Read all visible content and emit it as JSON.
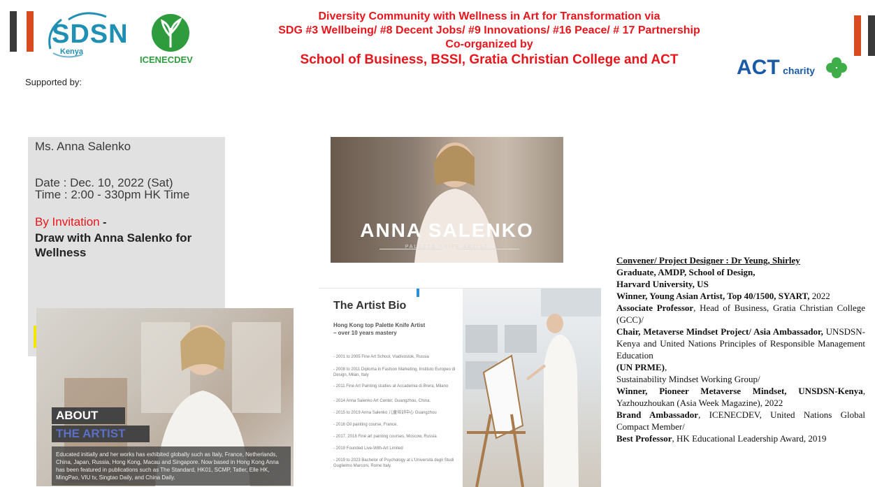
{
  "header": {
    "title_lines": [
      "Diversity Community with Wellness in Art for Transformation via",
      "SDG #3 Wellbeing/ #8 Decent Jobs/ #9 Innovations/ #16 Peace/ # 17 Partnership",
      "Co-organized by",
      "School of Business, BSSI, Gratia Christian College and ACT"
    ],
    "supported_by": "Supported by:",
    "logos": {
      "sdsn": "SDSN",
      "sdsn_sub": "Kenya",
      "icenecdev": "ICENECDEV",
      "act": "ACT",
      "act_sub": "charity"
    }
  },
  "event": {
    "speaker": "Ms. Anna Salenko",
    "date": "Date : Dec. 10, 2022 (Sat)",
    "time": "Time : 2:00 - 330pm HK Time",
    "invitation": "By Invitation",
    "invitation_dash": "-",
    "session_line1": "Draw with Anna Salenko for",
    "session_line2": "Wellness"
  },
  "about": {
    "title": "ABOUT",
    "subtitle": "THE ARTIST",
    "description": "Educated initially and her works has exhibited globally such as Italy, France, Netherlands, China, Japan, Russia, Hong Kong, Macau and Singapore. Now based in Hong Kong Anna has been featured in publications such as The Standard, HK01, SCMP, Tatler, Elle HK, MingPao, VIU tv, Singtao Daily, and China Daily."
  },
  "banner": {
    "name": "ANNA SALENKO",
    "tagline": "PALETTE KNIFE ARTIST"
  },
  "bio": {
    "title": "The Artist Bio",
    "subtitle_line1": "Hong Kong top Palette Knife Artist",
    "subtitle_line2": "– over 10 years mastery",
    "items": [
      "- 2001 to 2005 Fine Art School, Vladivostok, Russia",
      "- 2008 to 2011 Diploma in Fashion Marketing, Instituto Europeo di Design, Milan, Italy",
      "- 2011 Fine Art Painting studies at Accademia di Brera, Milano",
      "- 2014 Anna Salenko Art Center, Guangzhou, China.",
      "- 2015 to 2019 Anna Salenko 儿童培训中心 Guangzhou",
      "- 2016 Oil painting course, France.",
      "- 2017, 2018 Fine art painting courses, Moscow, Russia",
      "- 2019 Founded Live-With-Art Limited",
      "- 2019 to 2023 Bachelor of Psychology at L'Università degli Studi Guglielmo Marconi, Rome Italy."
    ]
  },
  "convener": {
    "heading": "Convener/ Project Designer : Dr Yeung, Shirley",
    "l1": "Graduate, AMDP, School of Design,",
    "l2": "Harvard University, US",
    "l3b": "Winner, Young Asian Artist, Top 40/1500, SYART,",
    "l3": "2022",
    "l4b": "Associate Professor",
    "l4": ", Head of Business, Gratia Christian College (GCC)/",
    "l5b": "Chair, Metaverse Mindset Project/ Asia Ambassador,",
    "l5": " UNSDSN-Kenya and United Nations Principles of Responsible Management Education",
    "l6b": "(UN PRME)",
    "l6": ",",
    "l7": "Sustainability Mindset Working Group/",
    "l8b": "Winner, Pioneer Metaverse Mindset, UNSDSN-Kenya",
    "l8": ", Yazhouzhoukan (Asia Week Magazine), 2022",
    "l9b": "Brand Ambassador",
    "l9": ", ICENECDEV, United Nations Global Compact Member/",
    "l10b": "Best Professor",
    "l10": ", HK Educational Leadership Award, 2019"
  },
  "colors": {
    "accent_red": "#e8161c",
    "sdsn_blue": "#1f8fb4",
    "icenec_green": "#2e9c3c",
    "act_blue": "#1b5aa6",
    "panel_gray": "#e1e1e1",
    "bar_orange": "#d84a1f",
    "bar_dark": "#3a3a3a"
  }
}
